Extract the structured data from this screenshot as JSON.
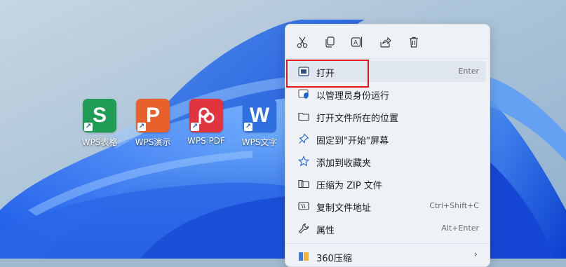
{
  "desktop": {
    "icons": [
      {
        "label": "WPS表格",
        "letter": "S",
        "color": "#1f9d55"
      },
      {
        "label": "WPS演示",
        "letter": "P",
        "color": "#e8602c"
      },
      {
        "label": "WPS PDF",
        "letter": "P",
        "color": "#e1343e"
      },
      {
        "label": "WPS文字",
        "letter": "W",
        "color": "#2f6fe0"
      }
    ]
  },
  "context_menu": {
    "toolbar": [
      {
        "icon": "cut-icon"
      },
      {
        "icon": "copy-icon"
      },
      {
        "icon": "rename-icon"
      },
      {
        "icon": "share-icon"
      },
      {
        "icon": "delete-icon"
      }
    ],
    "items": [
      {
        "label": "打开",
        "shortcut": "Enter",
        "icon": "open-icon"
      },
      {
        "label": "以管理员身份运行",
        "shortcut": "",
        "icon": "admin-shield-icon"
      },
      {
        "label": "打开文件所在的位置",
        "shortcut": "",
        "icon": "folder-icon"
      },
      {
        "label": "固定到\"开始\"屏幕",
        "shortcut": "",
        "icon": "pin-icon"
      },
      {
        "label": "添加到收藏夹",
        "shortcut": "",
        "icon": "star-icon"
      },
      {
        "label": "压缩为 ZIP 文件",
        "shortcut": "",
        "icon": "zip-folder-icon"
      },
      {
        "label": "复制文件地址",
        "shortcut": "Ctrl+Shift+C",
        "icon": "copy-path-icon"
      },
      {
        "label": "属性",
        "shortcut": "Alt+Enter",
        "icon": "wrench-icon"
      },
      {
        "label": "360压缩",
        "shortcut": "",
        "icon": "archive-icon",
        "submenu": true
      }
    ],
    "highlighted_item": "打开",
    "annotation_color": "#e11b1b"
  }
}
